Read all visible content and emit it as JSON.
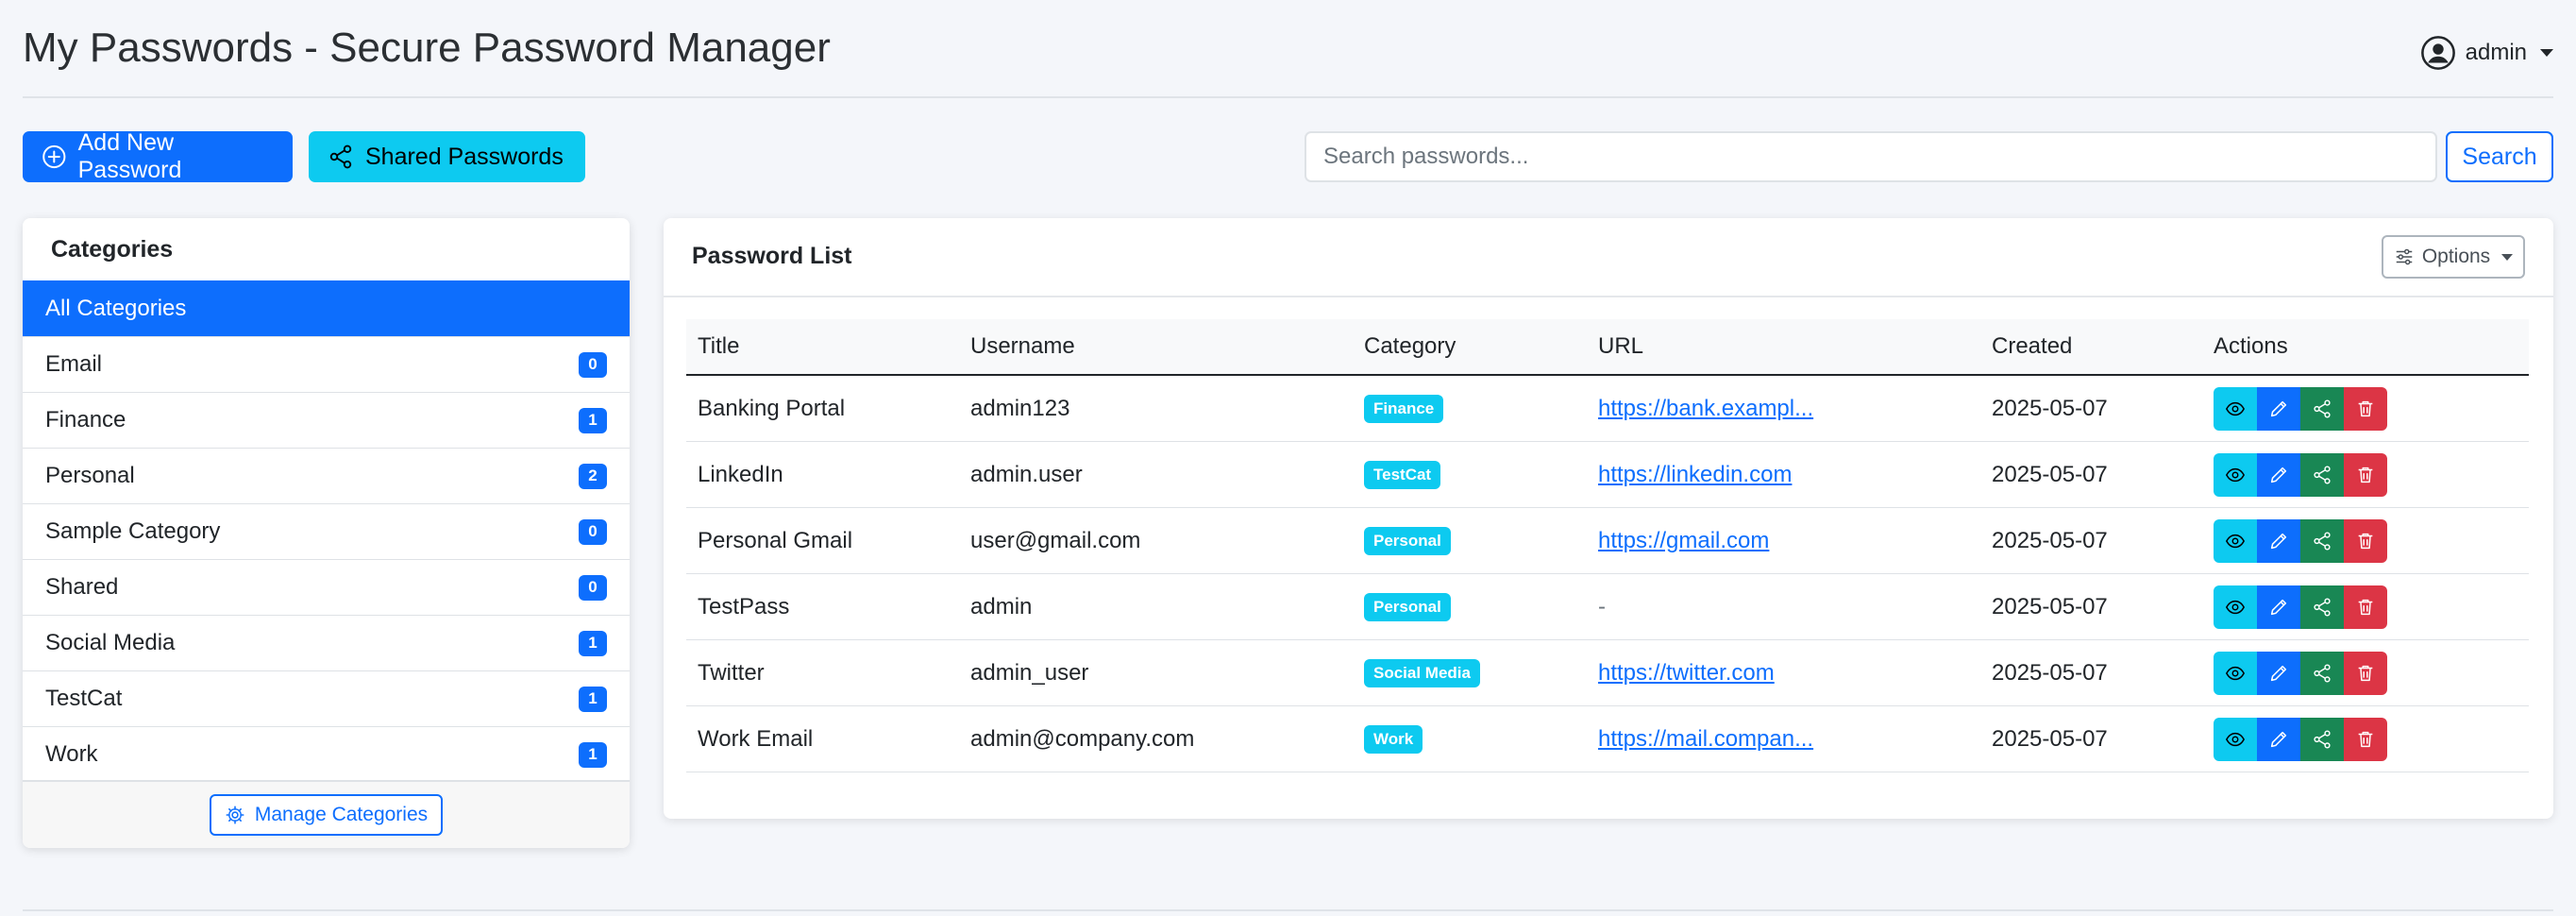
{
  "header": {
    "title": "My Passwords - Secure Password Manager",
    "user": "admin",
    "user_icon": "person-circle-icon"
  },
  "toolbar": {
    "add_label": "Add New Password",
    "shared_label": "Shared Passwords",
    "search_placeholder": "Search passwords...",
    "search_value": "",
    "search_label": "Search"
  },
  "categories": {
    "heading": "Categories",
    "items": [
      {
        "name": "All Categories",
        "active": true
      },
      {
        "name": "Email",
        "count": "0"
      },
      {
        "name": "Finance",
        "count": "1"
      },
      {
        "name": "Personal",
        "count": "2"
      },
      {
        "name": "Sample Category",
        "count": "0"
      },
      {
        "name": "Shared",
        "count": "0"
      },
      {
        "name": "Social Media",
        "count": "1"
      },
      {
        "name": "TestCat",
        "count": "1"
      },
      {
        "name": "Work",
        "count": "1"
      }
    ],
    "manage_label": "Manage Categories"
  },
  "password_list": {
    "title": "Password List",
    "options_label": "Options",
    "columns": [
      "Title",
      "Username",
      "Category",
      "URL",
      "Created",
      "Actions"
    ],
    "rows": [
      {
        "title": "Banking Portal",
        "username": "admin123",
        "category": "Finance",
        "url": "https://bank.exampl...",
        "created": "2025-05-07"
      },
      {
        "title": "LinkedIn",
        "username": "admin.user",
        "category": "TestCat",
        "url": "https://linkedin.com",
        "created": "2025-05-07"
      },
      {
        "title": "Personal Gmail",
        "username": "user@gmail.com",
        "category": "Personal",
        "url": "https://gmail.com",
        "created": "2025-05-07"
      },
      {
        "title": "TestPass",
        "username": "admin",
        "category": "Personal",
        "url": "-",
        "created": "2025-05-07"
      },
      {
        "title": "Twitter",
        "username": "admin_user",
        "category": "Social Media",
        "url": "https://twitter.com",
        "created": "2025-05-07"
      },
      {
        "title": "Work Email",
        "username": "admin@company.com",
        "category": "Work",
        "url": "https://mail.compan...",
        "created": "2025-05-07"
      }
    ]
  },
  "colors": {
    "primary": "#0d6efd",
    "info": "#0dcaf0",
    "success": "#198754",
    "danger": "#dc3545"
  }
}
